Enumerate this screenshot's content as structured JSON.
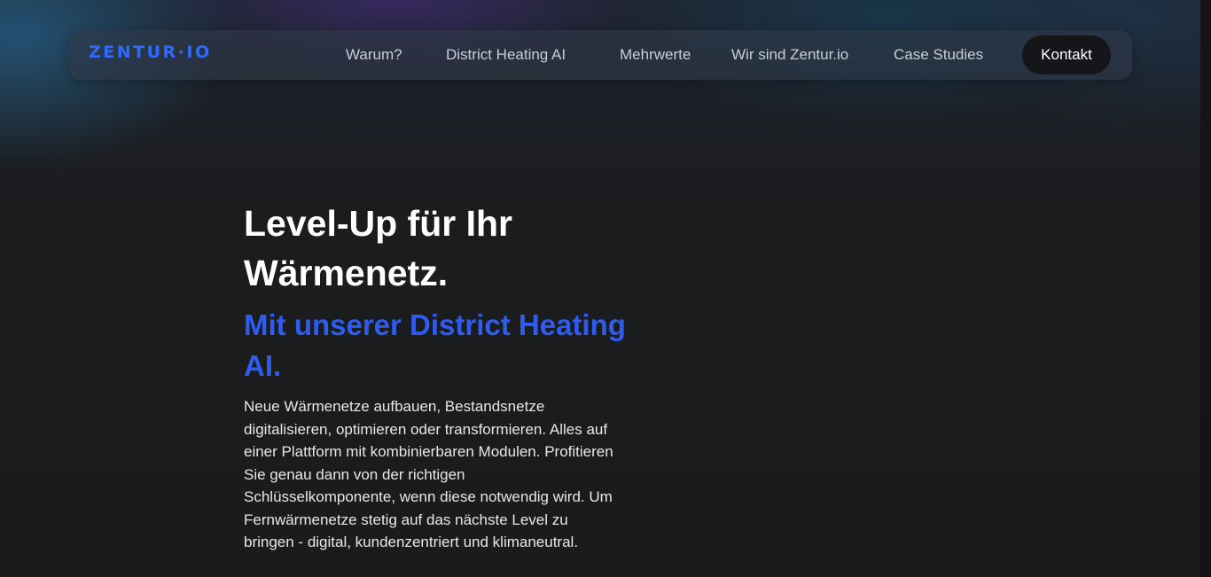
{
  "brand": {
    "logo_text": "ZENTUR·IO",
    "accent_color": "#2f6bff"
  },
  "nav": {
    "items": [
      {
        "label": "Warum?"
      },
      {
        "label": "District Heating AI"
      },
      {
        "label": "Mehrwerte"
      },
      {
        "label": "Wir sind Zentur.io"
      },
      {
        "label": "Case Studies"
      }
    ],
    "cta_label": "Kontakt"
  },
  "hero": {
    "title": "Level-Up für Ihr Wärmenetz.",
    "subtitle": "Mit unserer District Heating AI.",
    "subtitle_color": "#2f5cf0",
    "body": "Neue Wärmenetze aufbauen, Bestandsnetze digitalisieren, optimieren oder transformieren. Alles auf einer Plattform mit kombinierbaren Modulen. Profitieren Sie genau dann von der richtigen Schlüsselkomponente, wenn diese notwendig wird. Um Fernwärmenetze stetig auf das nächste Level zu bringen - digital, kundenzentriert und klimaneutral."
  }
}
